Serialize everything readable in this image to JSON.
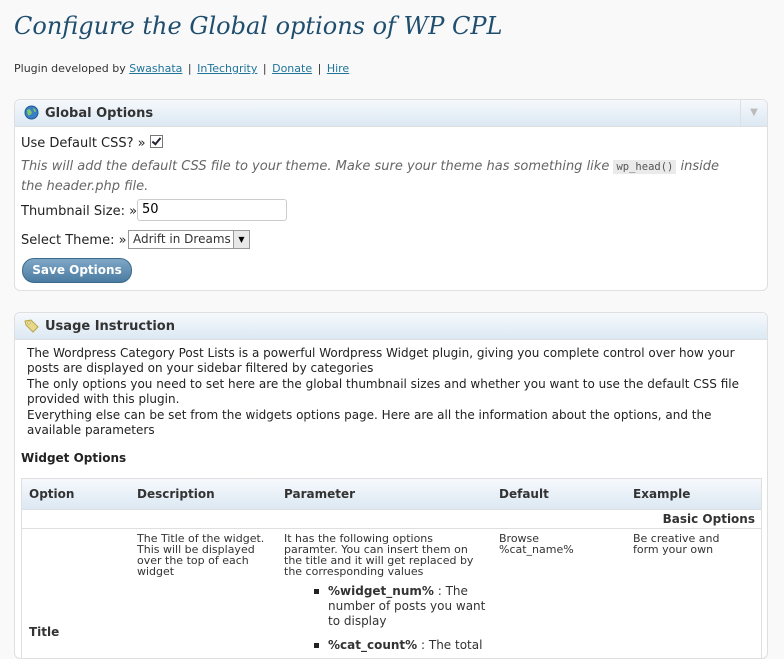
{
  "page": {
    "title": "Configure the Global options of WP CPL",
    "credits_prefix": "Plugin developed by",
    "links": [
      "Swashata",
      "InTechgrity",
      "Donate",
      "Hire"
    ],
    "separator": "|"
  },
  "global_options": {
    "title": "Global Options",
    "default_css_label": "Use Default CSS? »",
    "default_css_checked": true,
    "hint_before": "This will add the default CSS file to your theme. Make sure your theme has something like",
    "hint_code": "wp_head()",
    "hint_after": "inside the header.php file.",
    "thumbnail_label": "Thumbnail Size: »",
    "thumbnail_value": "50",
    "theme_label": "Select Theme: »",
    "theme_value": "Adrift in Dreams",
    "save_label": "Save Options",
    "toggle_icon": "▼"
  },
  "usage": {
    "title": "Usage Instruction",
    "paragraphs": [
      "The Wordpress Category Post Lists is a powerful Wordpress Widget plugin, giving you complete control over how your posts are displayed on your sidebar filtered by categories",
      "The only options you need to set here are the global thumbnail sizes and whether you want to use the default CSS file provided with this plugin.",
      "Everything else can be set from the widgets options page. Here are all the information about the options, and the available parameters"
    ],
    "widget_heading": "Widget Options",
    "table": {
      "headers": [
        "Option",
        "Description",
        "Parameter",
        "Default",
        "Example"
      ],
      "section": "Basic Options",
      "row": {
        "option": "Title",
        "description": "The Title of the widget. This will be displayed over the top of each widget",
        "parameter": "It has the following options paramter. You can insert them on the title and it will get replaced by the corresponding values",
        "params": [
          {
            "key": "%widget_num%",
            "text": " : The number of posts you want to display"
          },
          {
            "key": "%cat_count%",
            "text": " : The total"
          }
        ],
        "default": "Browse %cat_name%",
        "example": "Be creative and form your own"
      }
    }
  }
}
